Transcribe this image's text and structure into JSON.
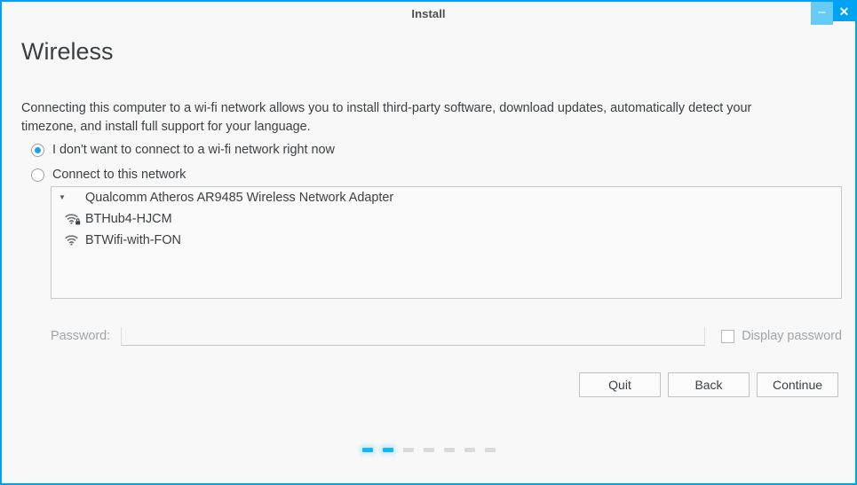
{
  "window": {
    "title": "Install",
    "border_color": "#00a2f3",
    "background_color": "#f8f8f8",
    "controls": {
      "minimize_label": "–",
      "minimize_icon": "minimize-icon",
      "close_label": "✕",
      "close_icon": "close-icon"
    }
  },
  "page": {
    "title": "Wireless",
    "description": "Connecting this computer to a wi-fi network allows you to install third-party software, download updates, automatically detect your timezone, and install full support for your language."
  },
  "options": [
    {
      "id": "no-connect",
      "label": "I don't want to connect to a wi-fi network right now",
      "checked": true
    },
    {
      "id": "connect",
      "label": "Connect to this network",
      "checked": false
    }
  ],
  "network_list": {
    "adapter": {
      "label": "Qualcomm Atheros AR9485 Wireless Network Adapter",
      "expanded": true,
      "disclosure_icon": "chevron-down-icon"
    },
    "networks": [
      {
        "ssid": "BTHub4-HJCM",
        "secured": true,
        "icon": "wifi-locked-icon"
      },
      {
        "ssid": "BTWifi-with-FON",
        "secured": false,
        "icon": "wifi-icon"
      }
    ]
  },
  "password": {
    "label": "Password:",
    "value": "",
    "placeholder": "",
    "enabled": false,
    "display_password_label": "Display password",
    "display_password_checked": false
  },
  "buttons": [
    {
      "id": "quit",
      "label": "Quit"
    },
    {
      "id": "back",
      "label": "Back"
    },
    {
      "id": "continue",
      "label": "Continue"
    }
  ],
  "progress": {
    "total_steps": 7,
    "active_steps": 2,
    "active_color": "#17b4f7",
    "inactive_color": "#d8dadc"
  }
}
